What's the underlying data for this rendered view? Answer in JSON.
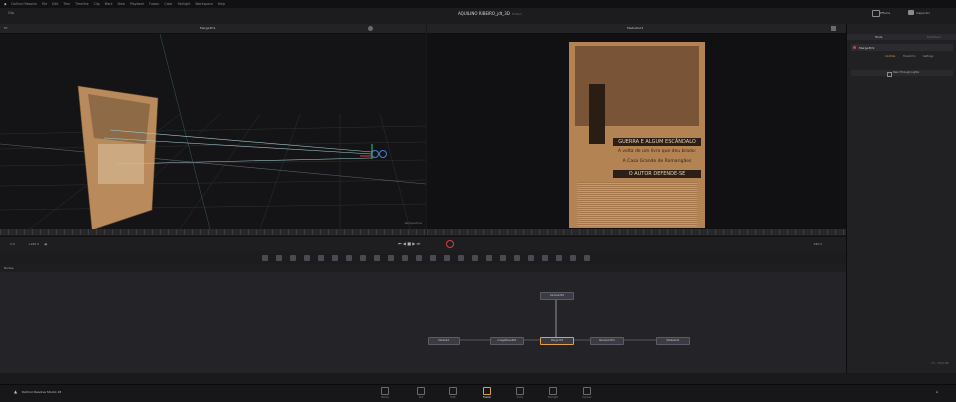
{
  "menu": {
    "items": [
      "DaVinci Resolve",
      "File",
      "Edit",
      "Trim",
      "Timeline",
      "Clip",
      "Mark",
      "View",
      "Playback",
      "Fusion",
      "Color",
      "Fairlight",
      "Workspace",
      "Help"
    ]
  },
  "titlebar": {
    "left_label": "Clip",
    "project_title": "AQUILINO RIBEIRO_jdt_3D",
    "edited_status": "Edited",
    "effects_label": "Effects",
    "inspector_label": "Inspector"
  },
  "viewer_left": {
    "zoom": "Fit",
    "title": "Merge3D1",
    "perspective_label": "Perspective"
  },
  "viewer_right": {
    "title": "MediaOut1"
  },
  "newspaper": {
    "headline1": "GUERRA E ALGUM ESCÂNDALO",
    "headline2": "A volta de um livro que deu brado:",
    "headline3": "A Casa Grande de Romarigães",
    "headline4": "O AUTOR DEFENDE-SE"
  },
  "transport": {
    "left_time": "0.0",
    "left_end": "+180.0",
    "right_time": "180.0"
  },
  "nodes_panel": {
    "label": "Nodes"
  },
  "node_graph": {
    "nodes": [
      "MediaIn1",
      "ImagePlane3D1",
      "Merge3D1",
      "Renderer3D1",
      "MediaOut1",
      "Camera3D1"
    ]
  },
  "inspector": {
    "tab_tools": "Tools",
    "tab_modifiers": "Modifiers",
    "node_name": "Merge3D1",
    "sub_tabs": [
      "Controls",
      "Transform",
      "Settings"
    ],
    "row_label": "Pass Through Lights"
  },
  "statusbar": {
    "app_name": "DaVinci Resolve Studio 18",
    "zoom_readout": "2% - 3500 MB"
  },
  "pages": [
    {
      "label": "Media",
      "icon": "media-page-icon"
    },
    {
      "label": "Cut",
      "icon": "cut-page-icon"
    },
    {
      "label": "Edit",
      "icon": "edit-page-icon"
    },
    {
      "label": "Fusion",
      "icon": "fusion-page-icon",
      "active": true
    },
    {
      "label": "Color",
      "icon": "color-page-icon"
    },
    {
      "label": "Fairlight",
      "icon": "fairlight-page-icon"
    },
    {
      "label": "Deliver",
      "icon": "deliver-page-icon"
    }
  ],
  "colors": {
    "accent": "#e0a040",
    "link_green": "#3cc08a",
    "selected_blue": "#4a7bd0"
  }
}
